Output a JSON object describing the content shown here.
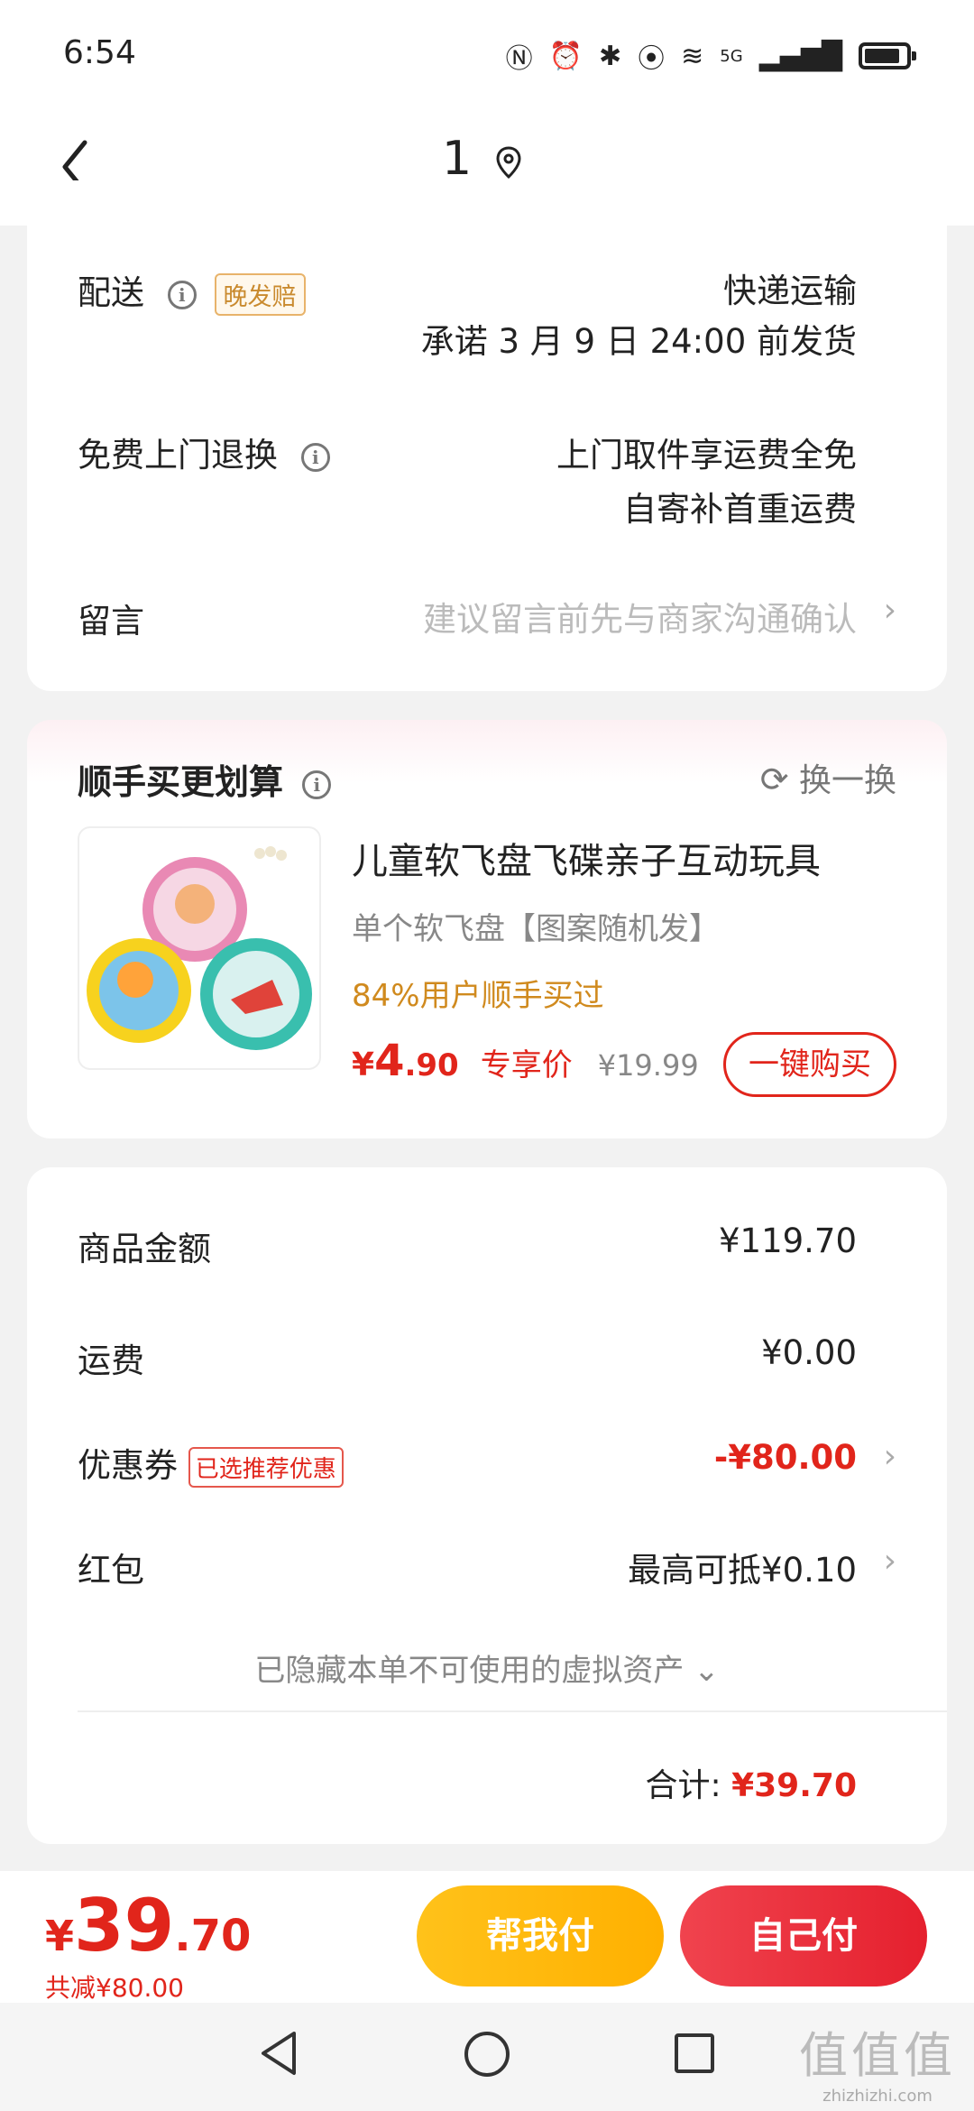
{
  "status_bar": {
    "time": "6:54",
    "network": "5G"
  },
  "nav": {
    "title": "1"
  },
  "delivery": {
    "label": "配送",
    "tag": "晚发赔",
    "method": "快递运输",
    "promise": "承诺 3 月 9 日 24:00 前发货"
  },
  "returns": {
    "label": "免费上门退换",
    "line1": "上门取件享运费全免",
    "line2": "自寄补首重运费"
  },
  "message": {
    "label": "留言",
    "placeholder": "建议留言前先与商家沟通确认"
  },
  "bundle": {
    "title": "顺手买更划算",
    "swap_label": "换一换",
    "product": {
      "name": "儿童软飞盘飞碟亲子互动玩具",
      "variant": "单个软飞盘【图案随机发】",
      "hint": "84%用户顺手买过",
      "price_currency": "¥",
      "price_int": "4",
      "price_dec": ".90",
      "price_label": "专享价",
      "original_price": "¥19.99",
      "buy_label": "一键购买"
    }
  },
  "summary": {
    "goods_label": "商品金额",
    "goods_value": "¥119.70",
    "shipping_label": "运费",
    "shipping_value": "¥0.00",
    "coupon_label": "优惠券",
    "coupon_tag": "已选推荐优惠",
    "coupon_value": "-¥80.00",
    "redpacket_label": "红包",
    "redpacket_value": "最高可抵¥0.10",
    "hidden_assets": "已隐藏本单不可使用的虚拟资产",
    "total_label": "合计:",
    "total_value": "¥39.70"
  },
  "bottom": {
    "currency": "¥",
    "price_int": "39",
    "price_dec": ".70",
    "savings": "共减¥80.00",
    "help_pay": "帮我付",
    "self_pay": "自己付"
  },
  "watermark": {
    "logo": "值值值",
    "site": "zhizhizhi.com"
  },
  "colors": {
    "accent_red": "#e1251b",
    "warning_orange": "#d08a1e",
    "help_button": "#ffb000"
  }
}
